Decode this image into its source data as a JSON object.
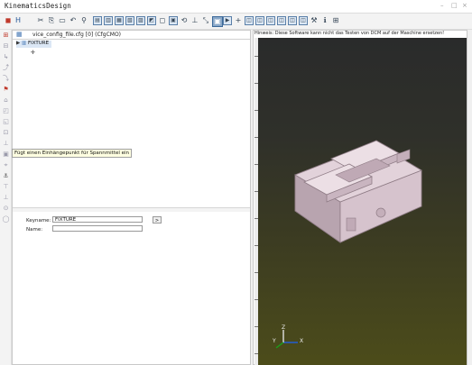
{
  "window": {
    "title": "KinematicsDesign",
    "controls": [
      "–",
      "□",
      "×"
    ]
  },
  "toolbar": {
    "icons": [
      "save-icon",
      "cut-icon",
      "copy-icon",
      "paste-icon",
      "undo-icon",
      "find-icon",
      "view-icon",
      "view-icon",
      "view-icon",
      "view-icon",
      "view-icon",
      "view-icon",
      "view-icon",
      "view-icon",
      "view-icon",
      "view-icon",
      "view-icon",
      "view-icon",
      "view-icon",
      "view-icon",
      "add-icon",
      "view-icon",
      "view-icon",
      "view-icon",
      "view-icon",
      "view-icon",
      "view-icon",
      "tool-icon",
      "info-icon",
      "grid-icon"
    ]
  },
  "file": {
    "name": "vice_config_file.cfg  [0]  (CfgCMO)"
  },
  "tree": {
    "node_label": "FIXTURE"
  },
  "tooltip": {
    "text": "Fügt einen Einhängepunkt für Spannmittel ein"
  },
  "properties": {
    "keyname_label": "Keyname:",
    "keyname_value": "FIXTURE",
    "name_label": "Name:",
    "name_value": "",
    "go_label": ">"
  },
  "viewport": {
    "hint": "Hinweis: Diese Software kann nicht das Testen von DCM auf der Maschine ersetzen!",
    "axis_x": "X",
    "axis_y": "Y",
    "axis_z": "Z"
  },
  "colors": {
    "model": "#d9c5cf",
    "axis_x": "#1f5fe0",
    "axis_y": "#1aa01a",
    "axis_z": "#e0e0e0"
  }
}
